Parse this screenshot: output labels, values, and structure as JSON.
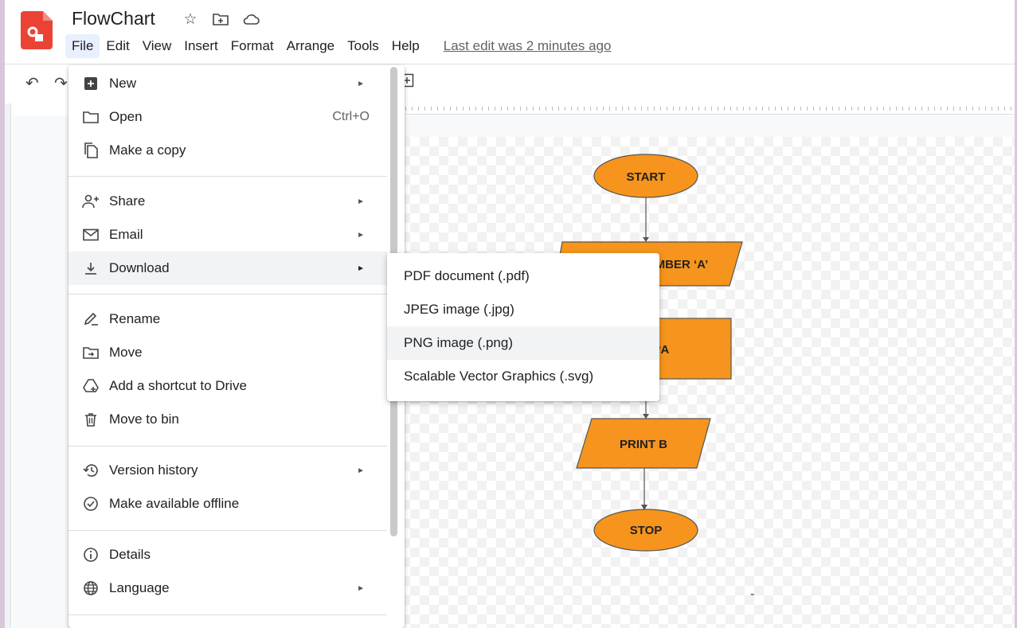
{
  "app": {
    "title": "FlowChart",
    "title_icons": [
      "star-icon",
      "move-to-folder-icon",
      "cloud-status-icon"
    ],
    "last_edit": "Last edit was 2 minutes ago"
  },
  "menubar": {
    "items": [
      "File",
      "Edit",
      "View",
      "Insert",
      "Format",
      "Arrange",
      "Tools",
      "Help"
    ],
    "active": "File"
  },
  "file_menu": {
    "items": [
      {
        "icon": "new-icon",
        "label": "New",
        "shortcut": "",
        "submenu": true
      },
      {
        "icon": "folder-icon",
        "label": "Open",
        "shortcut": "Ctrl+O",
        "submenu": false
      },
      {
        "icon": "copy-icon",
        "label": "Make a copy",
        "shortcut": "",
        "submenu": false
      },
      {
        "icon": "share-icon",
        "label": "Share",
        "shortcut": "",
        "submenu": true
      },
      {
        "icon": "email-icon",
        "label": "Email",
        "shortcut": "",
        "submenu": true
      },
      {
        "icon": "download-icon",
        "label": "Download",
        "shortcut": "",
        "submenu": true
      },
      {
        "icon": "rename-icon",
        "label": "Rename",
        "shortcut": "",
        "submenu": false
      },
      {
        "icon": "move-icon",
        "label": "Move",
        "shortcut": "",
        "submenu": false
      },
      {
        "icon": "drive-shortcut-icon",
        "label": "Add a shortcut to Drive",
        "shortcut": "",
        "submenu": false
      },
      {
        "icon": "trash-icon",
        "label": "Move to bin",
        "shortcut": "",
        "submenu": false
      },
      {
        "icon": "history-icon",
        "label": "Version history",
        "shortcut": "",
        "submenu": true
      },
      {
        "icon": "offline-icon",
        "label": "Make available offline",
        "shortcut": "",
        "submenu": false
      },
      {
        "icon": "info-icon",
        "label": "Details",
        "shortcut": "",
        "submenu": false
      },
      {
        "icon": "globe-icon",
        "label": "Language",
        "shortcut": "",
        "submenu": true
      }
    ],
    "highlighted": "Download"
  },
  "download_submenu": {
    "items": [
      "PDF document (.pdf)",
      "JPEG image (.jpg)",
      "PNG image (.png)",
      "Scalable Vector Graphics (.svg)"
    ],
    "highlighted": "PNG image (.png)"
  },
  "flowchart": {
    "nodes": [
      {
        "label": "START",
        "shape": "ellipse"
      },
      {
        "label": "MBER ‘A’",
        "shape": "parallelogram"
      },
      {
        "label": "*A",
        "shape": "rectangle"
      },
      {
        "label": "PRINT B",
        "shape": "parallelogram"
      },
      {
        "label": "STOP",
        "shape": "ellipse"
      }
    ],
    "fill_color": "#f7941d",
    "stroke_color": "#555555"
  },
  "colors": {
    "menu_active_bg": "#e8f0fe",
    "hover_bg": "#f1f3f4",
    "logo_red": "#ea4335"
  }
}
